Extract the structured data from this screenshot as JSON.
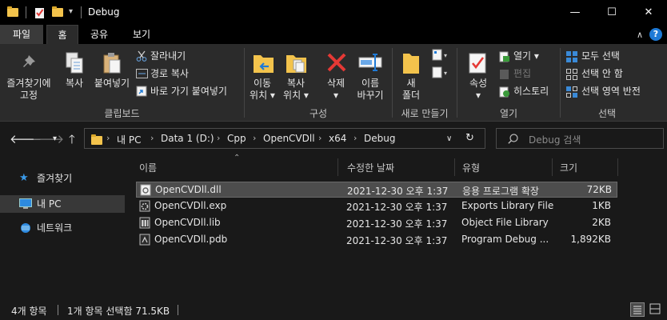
{
  "window": {
    "title": "Debug",
    "minimize_glyph": "—",
    "maximize_glyph": "☐",
    "close_glyph": "✕"
  },
  "quick_access": {
    "customize_glyph": "▾"
  },
  "tabs": {
    "file": "파일",
    "home": "홈",
    "share": "공유",
    "view": "보기",
    "help_glyph": "?",
    "collapse_glyph": "∧"
  },
  "ribbon": {
    "clipboard": {
      "pin": "즐겨찾기에\n고정",
      "copy": "복사",
      "paste": "붙여넣기",
      "cut": "잘라내기",
      "copy_path": "경로 복사",
      "paste_shortcut": "바로 가기 붙여넣기",
      "group": "클립보드"
    },
    "organize": {
      "move_to": "이동\n위치 ▾",
      "copy_to": "복사\n위치 ▾",
      "delete": "삭제\n▾",
      "rename": "이름\n바꾸기",
      "group": "구성"
    },
    "new": {
      "new_folder": "새\n폴더",
      "group": "새로 만들기"
    },
    "open": {
      "properties": "속성\n▾",
      "open": "열기 ▾",
      "edit": "편집",
      "history": "히스토리",
      "group": "열기"
    },
    "select": {
      "select_all": "모두 선택",
      "select_none": "선택 안 함",
      "invert": "선택 영역 반전",
      "group": "선택"
    }
  },
  "address": {
    "crumbs": [
      "내 PC",
      "Data 1 (D:)",
      "Cpp",
      "OpenCVDll",
      "x64",
      "Debug"
    ],
    "search_placeholder": "Debug 검색"
  },
  "nav": {
    "favorites": "즐겨찾기",
    "this_pc": "내 PC",
    "network": "네트워크"
  },
  "columns": {
    "name": "이름",
    "modified": "수정한 날짜",
    "type": "유형",
    "size": "크기"
  },
  "files": [
    {
      "name": "OpenCVDll.dll",
      "date": "2021-12-30 오후 1:37",
      "type": "응용 프로그램 확장",
      "size": "72KB",
      "icon": "dll-icon"
    },
    {
      "name": "OpenCVDll.exp",
      "date": "2021-12-30 오후 1:37",
      "type": "Exports Library File",
      "size": "1KB",
      "icon": "exp-icon"
    },
    {
      "name": "OpenCVDll.lib",
      "date": "2021-12-30 오후 1:37",
      "type": "Object File Library",
      "size": "2KB",
      "icon": "lib-icon"
    },
    {
      "name": "OpenCVDll.pdb",
      "date": "2021-12-30 오후 1:37",
      "type": "Program Debug ...",
      "size": "1,892KB",
      "icon": "pdb-icon"
    }
  ],
  "status": {
    "item_count": "4개 항목",
    "selection": "1개 항목 선택함 71.5KB"
  },
  "colors": {
    "accent": "#1e7ad6",
    "folder": "#f3c34c",
    "delete_red": "#e53935"
  }
}
